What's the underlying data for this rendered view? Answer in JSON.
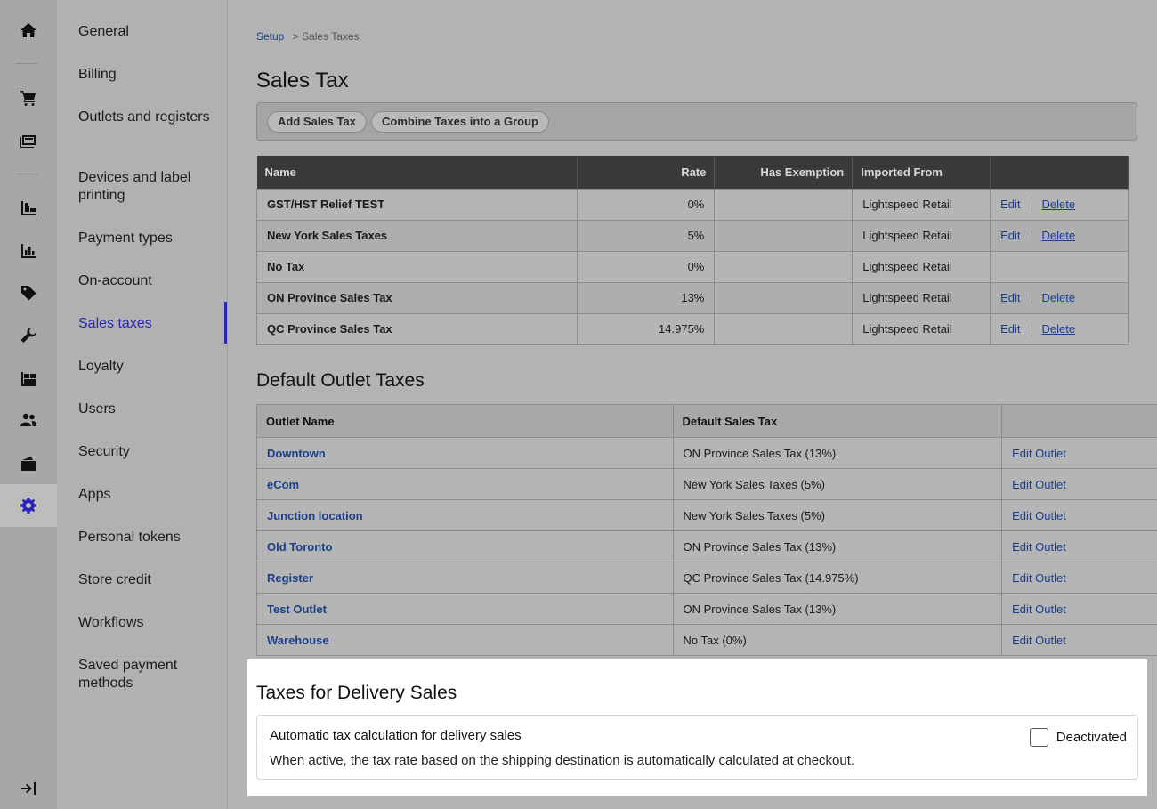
{
  "nav": {
    "items": [
      {
        "label": "General"
      },
      {
        "label": "Billing"
      },
      {
        "label": "Outlets and registers"
      },
      {
        "label": "Devices and label printing"
      },
      {
        "label": "Payment types"
      },
      {
        "label": "On-account"
      },
      {
        "label": "Sales taxes"
      },
      {
        "label": "Loyalty"
      },
      {
        "label": "Users"
      },
      {
        "label": "Security"
      },
      {
        "label": "Apps"
      },
      {
        "label": "Personal tokens"
      },
      {
        "label": "Store credit"
      },
      {
        "label": "Workflows"
      },
      {
        "label": "Saved payment methods"
      }
    ],
    "active": "Sales taxes"
  },
  "rail": {
    "icons": [
      "home-icon",
      "cart-icon",
      "register-icon",
      "catalog-icon",
      "reports-icon",
      "tag-icon",
      "wrench-icon",
      "inventory-icon",
      "customers-icon",
      "wallet-icon",
      "gear-icon",
      "collapse-icon"
    ],
    "active_color": "#2a24b8"
  },
  "breadcrumb": {
    "root": "Setup",
    "separator": ">",
    "current": "Sales Taxes"
  },
  "page_title": "Sales Tax",
  "toolbar": {
    "add_label": "Add Sales Tax",
    "combine_label": "Combine Taxes into a Group"
  },
  "taxes": {
    "headers": [
      "Name",
      "Rate",
      "Has Exemption",
      "Imported From",
      ""
    ],
    "rows": [
      {
        "name": "GST/HST Relief TEST",
        "rate": "0%",
        "exemption": "",
        "imported": "Lightspeed Retail",
        "edit": "Edit",
        "delete": "Delete"
      },
      {
        "name": "New York Sales Taxes",
        "rate": "5%",
        "exemption": "",
        "imported": "Lightspeed Retail",
        "edit": "Edit",
        "delete": "Delete"
      },
      {
        "name": "No Tax",
        "rate": "0%",
        "exemption": "",
        "imported": "Lightspeed Retail",
        "edit": "",
        "delete": ""
      },
      {
        "name": "ON Province Sales Tax",
        "rate": "13%",
        "exemption": "",
        "imported": "Lightspeed Retail",
        "edit": "Edit",
        "delete": "Delete"
      },
      {
        "name": "QC Province Sales Tax",
        "rate": "14.975%",
        "exemption": "",
        "imported": "Lightspeed Retail",
        "edit": "Edit",
        "delete": "Delete"
      }
    ]
  },
  "outlets_title": "Default Outlet Taxes",
  "outlets": {
    "headers": [
      "Outlet Name",
      "Default Sales Tax",
      ""
    ],
    "rows": [
      {
        "name": "Downtown",
        "tax": "ON Province Sales Tax (13%)",
        "action": "Edit Outlet"
      },
      {
        "name": "eCom",
        "tax": "New York Sales Taxes (5%)",
        "action": "Edit Outlet"
      },
      {
        "name": "Junction location",
        "tax": "New York Sales Taxes (5%)",
        "action": "Edit Outlet"
      },
      {
        "name": "Old Toronto",
        "tax": "ON Province Sales Tax (13%)",
        "action": "Edit Outlet"
      },
      {
        "name": "Register",
        "tax": "QC Province Sales Tax (14.975%)",
        "action": "Edit Outlet"
      },
      {
        "name": "Test Outlet",
        "tax": "ON Province Sales Tax (13%)",
        "action": "Edit Outlet"
      },
      {
        "name": "Warehouse",
        "tax": "No Tax (0%)",
        "action": "Edit Outlet"
      }
    ]
  },
  "delivery": {
    "title": "Taxes for Delivery Sales",
    "setting_title": "Automatic tax calculation for delivery sales",
    "setting_desc": "When active, the tax rate based on the shipping destination is automatically calculated at checkout.",
    "toggle_label": "Deactivated",
    "checked": false
  }
}
